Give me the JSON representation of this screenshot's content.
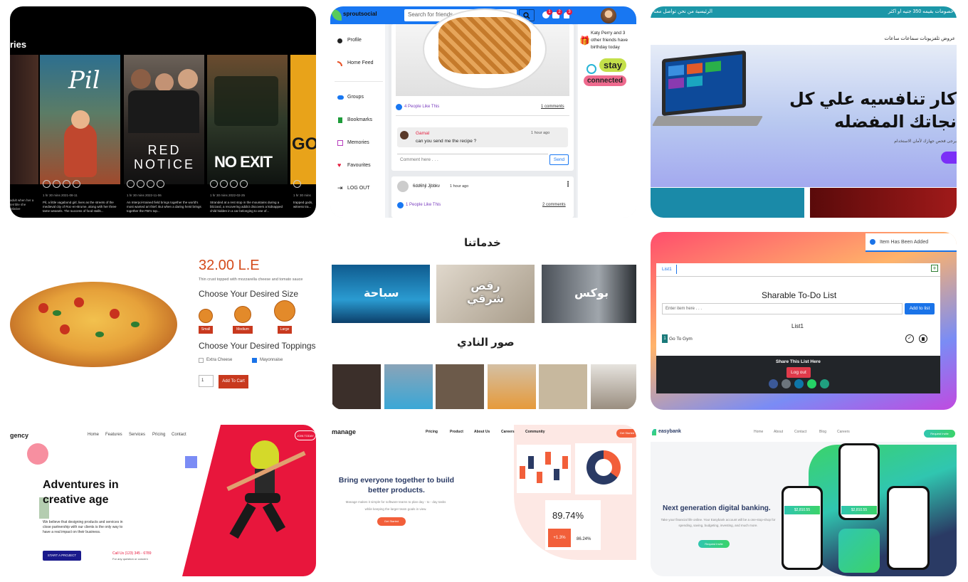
{
  "movies": {
    "heading_fragment": "ries",
    "posters": [
      {
        "title": "Pil",
        "meta": "1 hr 30 mins  2021-08-11",
        "desc": "Pil, a little vagabond girl, lives as the streets of the medieval city of Roc-en-Brume, along with her three tame weasels. The success of food stalls..."
      },
      {
        "title": "RED NOTICE",
        "meta": "1 hr 30 mins  2022-11-06",
        "desc": "An Interpol-trained field brings together the world's most wanted art thief. But when a daring heist brings together the FBI's top..."
      },
      {
        "title": "NO EXIT",
        "meta": "1 hr 30 mins  2022-02-25",
        "desc": "Stranded at a rest stop in the mountains during a blizzard, a recovering addict discovers a kidnapped child hidden in a car belonging to one of..."
      },
      {
        "title": "GOL",
        "meta": "1 hr 30 mins",
        "desc": "trapped gods, witness tra..."
      }
    ],
    "left_desc": "adult when her a terrible she relative"
  },
  "social": {
    "logo": "sproutsocial",
    "search_placeholder": "Search for friends ...",
    "badges": [
      "1",
      "2",
      "3"
    ],
    "nav": [
      "Profile",
      "Home Feed",
      "Groups",
      "Bookmarks",
      "Memories",
      "Favourites",
      "LOG OUT"
    ],
    "post1": {
      "likes": "4 People Like This",
      "comments": "1 comments"
    },
    "comment": {
      "name": "Gamal",
      "time": "1 hour ago",
      "text": "can you send me the recipe ?"
    },
    "comment_placeholder": "Comment here . . .",
    "send": "Send",
    "post2": {
      "name": "6dd6hjl Jjbbkv",
      "time": "1 hour ago",
      "likes": "1 People Like This",
      "comments": "2 comments"
    },
    "birthday": "Katy Perry and 3 other friends have birthday today",
    "stay1": "stay",
    "stay2": "connected"
  },
  "arabic_shop": {
    "top_left": "الرئيسية   من نحن   تواصل معنا",
    "top_right": "خصومات بقيمه 350 جنيه او اكثر",
    "nav": "عروض   تلفزيونات   سماعات   ساعات",
    "headline1": "كار تنافسيه علي كل",
    "headline2": "نجاتك المفضله",
    "sub": "يرجى فحص جهازك لأمان الاستخدام"
  },
  "pizza": {
    "price": "32.00 L.E",
    "desc": "Thin crust topped with mozzarella cheese and tomato sauce",
    "size_title": "Choose Your Desired Size",
    "sizes": [
      "Small",
      "Medium",
      "Large"
    ],
    "toppings_title": "Choose Your Desired Toppings",
    "toppings": [
      "Extra Cheese",
      "Mayonnaise"
    ],
    "qty": "1",
    "add": "Add To Cart"
  },
  "club": {
    "services_title": "خدماتنا",
    "services": [
      "سباحة",
      "رقص شرقي",
      "بوكس"
    ],
    "photos_title": "صور النادي"
  },
  "todo": {
    "toast": "Item Has Been Added",
    "tab": "List1",
    "title": "Sharable To-Do List",
    "input_placeholder": "Enter item here . . .",
    "add": "Add to list",
    "list_name": "List1",
    "item_num": "1",
    "item": "Go To Gym",
    "share": "Share This List Here",
    "logout": "Log out"
  },
  "agency": {
    "logo": "gency",
    "nav": [
      "Home",
      "Features",
      "Services",
      "Pricing",
      "Contact"
    ],
    "join": "JOIN TODAY",
    "headline1": "Adventures in",
    "headline2": "creative age",
    "body": "We believe that designing products and services in close partnership with our clients is the only way to have a real impact on their business.",
    "cta": "START A PROJECT",
    "call": "Call Us (123) 345 - 6789",
    "call_sub": "For any question or concern"
  },
  "manage": {
    "logo": "manage",
    "nav": [
      "Pricing",
      "Product",
      "About Us",
      "Careers",
      "Community"
    ],
    "get_started_nav": "Get Started",
    "headline1": "Bring everyone together to build",
    "headline2": "better products.",
    "body1": "Manage makes it simple for software teams to plan day - to - day tasks",
    "body2": "while keeping the larger team goals in view.",
    "cta": "Get Started",
    "stat_big": "89.74%",
    "stat_small1": "+1.3%",
    "stat_small2": "86.24%"
  },
  "easybank": {
    "logo": "easybank",
    "nav": [
      "Home",
      "About",
      "Contact",
      "Blog",
      "Careers"
    ],
    "request": "Request Invite",
    "headline": "Next generation digital banking.",
    "body": "Take your financial life online. Your Easybank account will be a one-stop-shop for spending, saving, budgeting, investing, and much more.",
    "cta": "Request Invite",
    "balance": "$2,810.55"
  }
}
